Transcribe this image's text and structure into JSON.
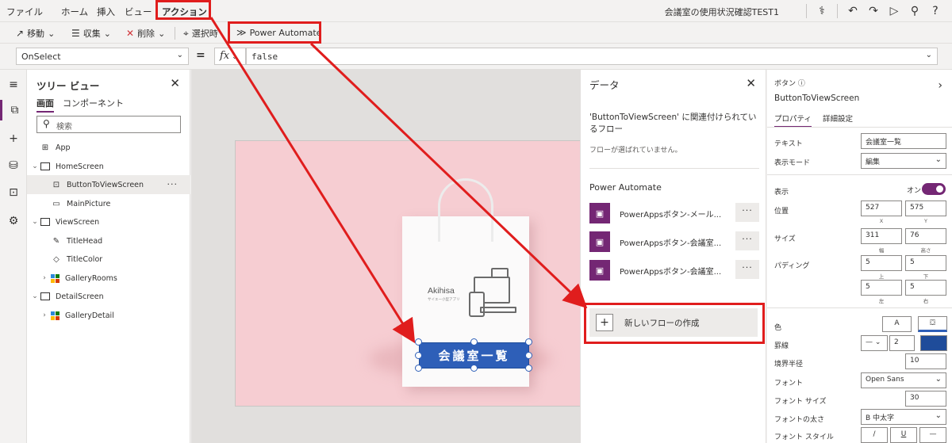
{
  "menu": {
    "items": [
      "ファイル",
      "ホーム",
      "挿入",
      "ビュー",
      "アクション"
    ],
    "app_title": "会議室の使用状況確認TEST1"
  },
  "toolbar": {
    "move": "移動",
    "collection": "収集",
    "delete": "削除",
    "on_select": "選択時",
    "power_automate": "Power Automate"
  },
  "formula": {
    "property": "OnSelect",
    "eq": "=",
    "fx": "fx",
    "value": "false"
  },
  "tree": {
    "title": "ツリー ビュー",
    "tabs": [
      "画面",
      "コンポーネント"
    ],
    "search_placeholder": "検索",
    "items": [
      {
        "label": "App"
      },
      {
        "label": "HomeScreen"
      },
      {
        "label": "ButtonToViewScreen"
      },
      {
        "label": "MainPicture"
      },
      {
        "label": "ViewScreen"
      },
      {
        "label": "TitleHead"
      },
      {
        "label": "TitleColor"
      },
      {
        "label": "GalleryRooms"
      },
      {
        "label": "DetailScreen"
      },
      {
        "label": "GalleryDetail"
      }
    ]
  },
  "canvas": {
    "button_text": "会議室一覧",
    "bag_brand": "Akihisa",
    "bag_sub": "サイエー小型アプリ"
  },
  "data_panel": {
    "title": "データ",
    "assoc_text": "'ButtonToViewScreen' に関連付けられているフロー",
    "no_flow_text": "フローが選ばれていません。",
    "section": "Power Automate",
    "flows": [
      {
        "label": "PowerAppsボタン-メール..."
      },
      {
        "label": "PowerAppsボタン-会議室..."
      },
      {
        "label": "PowerAppsボタン-会議室..."
      }
    ],
    "new_flow": "新しいフローの作成"
  },
  "props": {
    "type": "ボタン",
    "name": "ButtonToViewScreen",
    "tabs": [
      "プロパティ",
      "詳細設定"
    ],
    "text_label": "テキスト",
    "text_value": "会議室一覧",
    "display_mode_label": "表示モード",
    "display_mode_value": "編集",
    "visible_label": "表示",
    "visible_value": "オン",
    "position_label": "位置",
    "pos_x": "527",
    "pos_y": "575",
    "x_lbl": "X",
    "y_lbl": "Y",
    "size_label": "サイズ",
    "width": "311",
    "height": "76",
    "w_lbl": "幅",
    "h_lbl": "高さ",
    "padding_label": "パディング",
    "pad_top": "5",
    "pad_bottom": "5",
    "pad_left": "5",
    "pad_right": "5",
    "pad_top_lbl": "上",
    "pad_bottom_lbl": "下",
    "pad_left_lbl": "左",
    "pad_right_lbl": "右",
    "color_label": "色",
    "color_a": "A",
    "border_label": "罫線",
    "border_value": "2",
    "radius_label": "境界半径",
    "radius_value": "10",
    "font_label": "フォント",
    "font_value": "Open Sans",
    "font_size_label": "フォント サイズ",
    "font_size_value": "30",
    "font_weight_label": "フォントの太さ",
    "font_weight_value": "B 中太字",
    "font_style_label": "フォント スタイル",
    "style_italic": "/",
    "style_underline": "U",
    "style_strike": "—"
  },
  "colors": {
    "accent": "#742774",
    "button_fill": "#2e5fb8",
    "annotation": "#e01d1d",
    "canvas_bg": "#f6cdd2"
  }
}
